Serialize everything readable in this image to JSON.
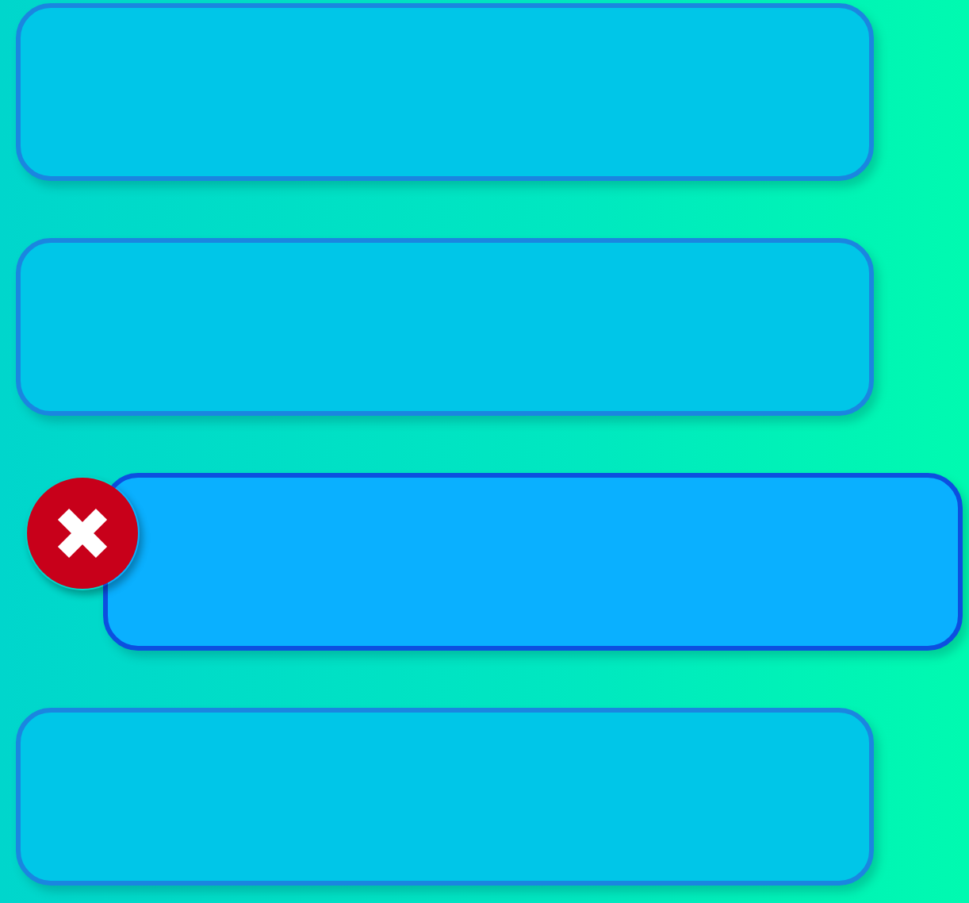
{
  "items": [
    {
      "selected": false
    },
    {
      "selected": false
    },
    {
      "selected": true
    },
    {
      "selected": false
    }
  ]
}
